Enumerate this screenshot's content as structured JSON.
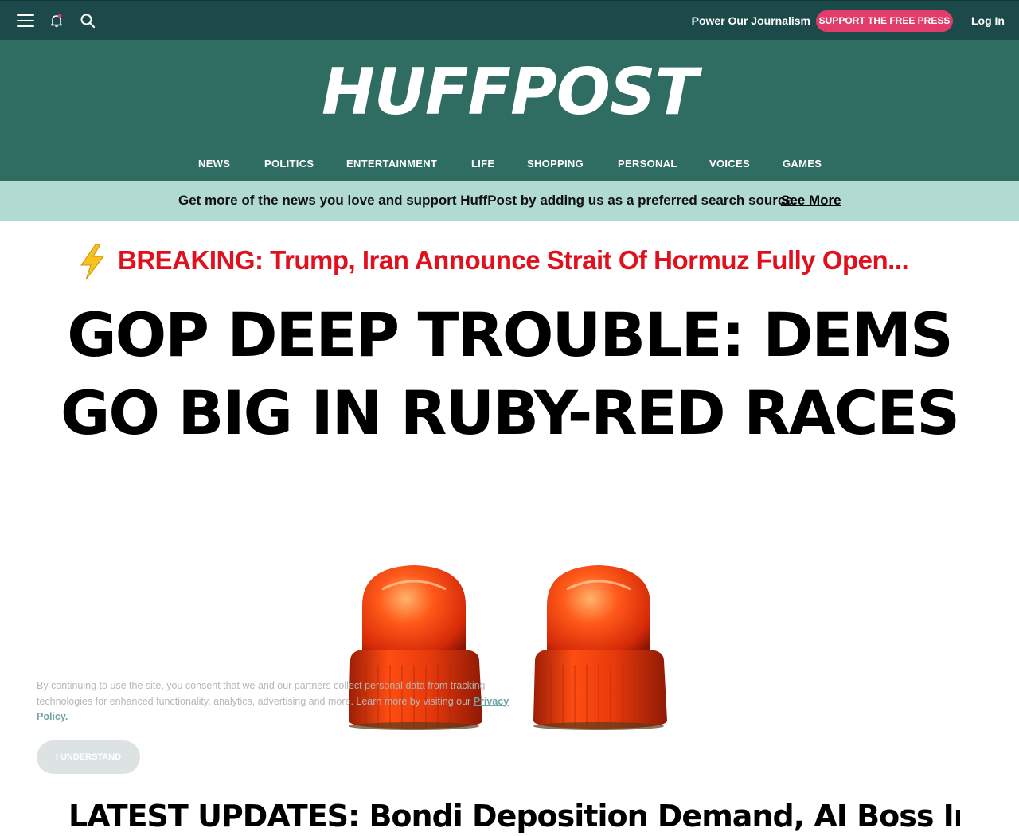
{
  "topbar": {
    "menu_icon": "hamburger-menu-icon",
    "notifications_icon": "bell-icon",
    "search_icon": "search-icon",
    "power_text": "Power Our Journalism",
    "support_label": "SUPPORT THE FREE PRESS",
    "login_label": "Log In",
    "colors": {
      "bar": "#1c4a4a",
      "support_button": "#e23d6a"
    }
  },
  "masthead": {
    "logo": "HUFFPOST",
    "nav": [
      "NEWS",
      "POLITICS",
      "ENTERTAINMENT",
      "LIFE",
      "SHOPPING",
      "PERSONAL",
      "VOICES",
      "GAMES"
    ],
    "colors": {
      "background": "#2f6d62"
    }
  },
  "promo": {
    "text": "Get more of the news you love and support HuffPost by adding us as a preferred search source.",
    "link": "See More",
    "colors": {
      "background": "#b1dbd2"
    }
  },
  "breaking": {
    "icon": "lightning-bolt-icon",
    "text": "BREAKING: Trump, Iran Announce Strait Of Hormuz Fully Open...",
    "colors": {
      "text": "#e0101c"
    }
  },
  "main": {
    "headline_line1": "GOP DEEP TROUBLE: DEMS",
    "headline_line2": "GO BIG IN RUBY-RED RACES",
    "image_subject": "two red emergency siren lights"
  },
  "cookie": {
    "text_before": "By continuing to use the site, you consent that we and our partners collect personal data from tracking technologies for enhanced functionality, analytics, advertising and more. Learn more by visiting our ",
    "link": "Privacy Policy.",
    "button": "I UNDERSTAND"
  },
  "next_headline": "LATEST UPDATES: Bondi Deposition Demand, AI Boss In W.H."
}
